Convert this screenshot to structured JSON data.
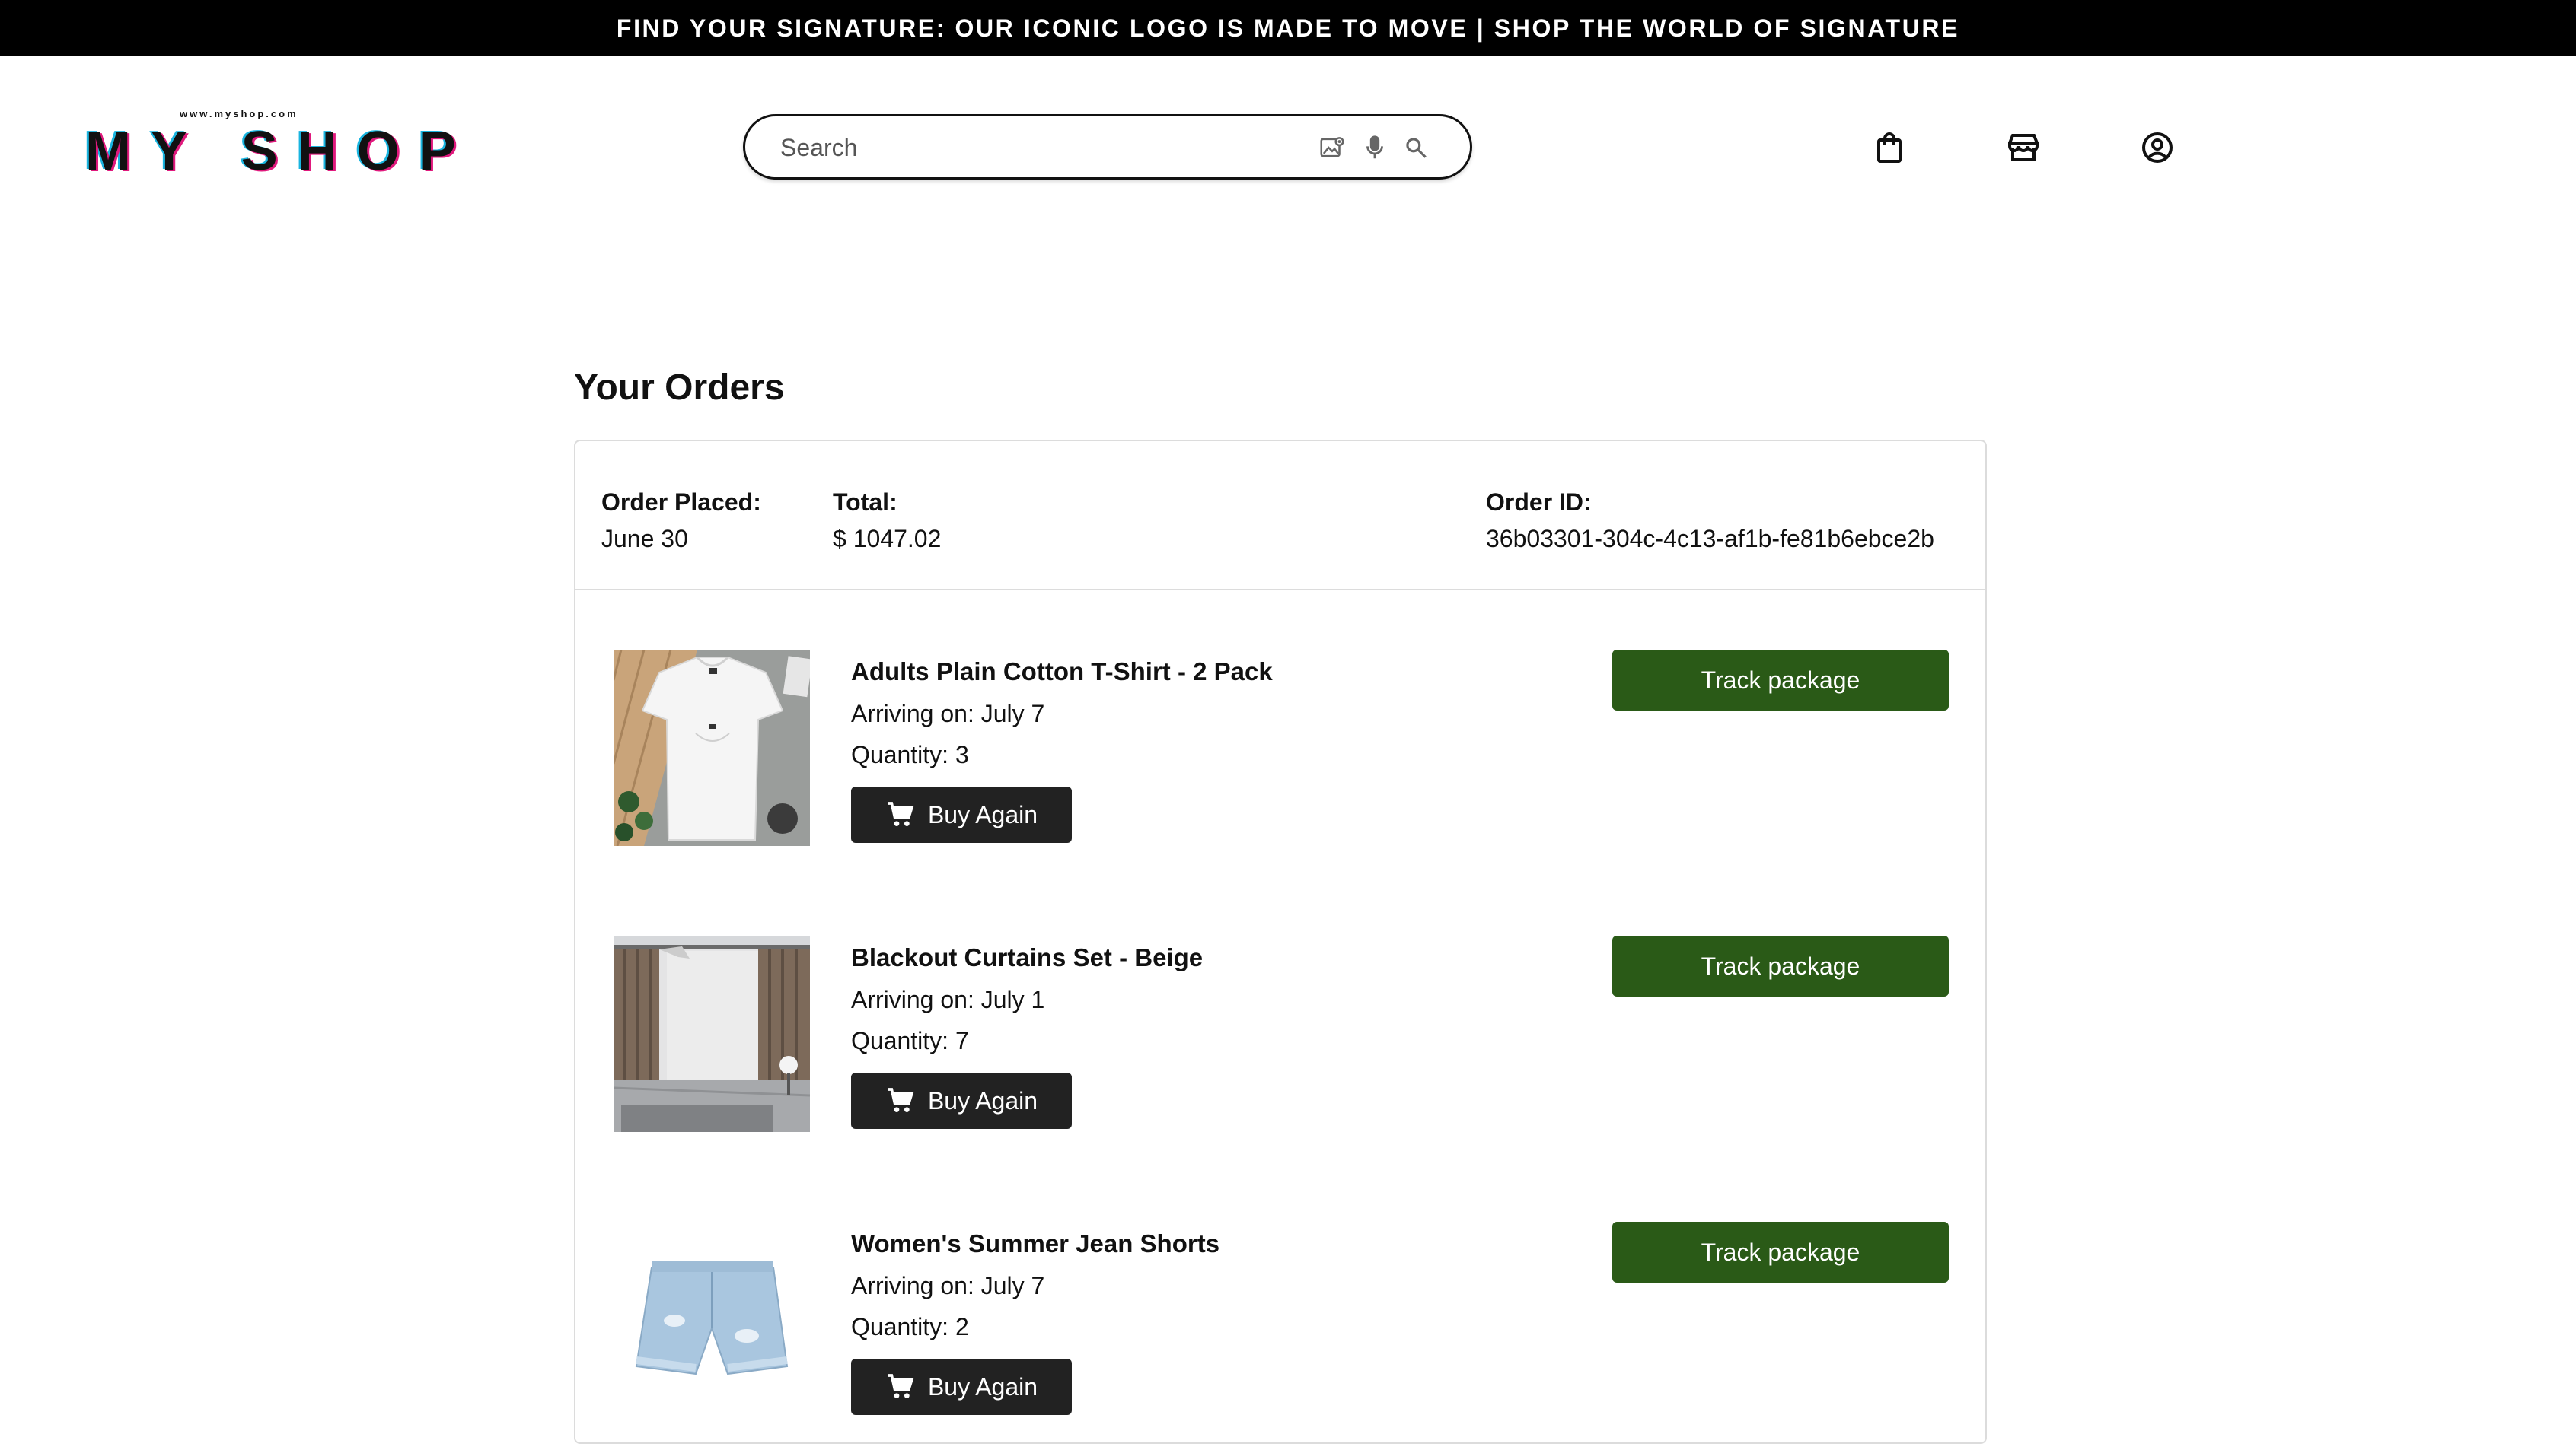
{
  "announcement": "FIND YOUR SIGNATURE: OUR ICONIC LOGO IS MADE TO MOVE | SHOP THE WORLD OF SIGNATURE",
  "logo": {
    "url": "www.myshop.com",
    "text": "MY SHOP"
  },
  "search": {
    "placeholder": "Search"
  },
  "header_icons": [
    "shopping-bag-icon",
    "store-icon",
    "account-icon"
  ],
  "page_title": "Your Orders",
  "order": {
    "placed_label": "Order Placed:",
    "placed_value": "June 30",
    "total_label": "Total:",
    "total_value": "$ 1047.02",
    "id_label": "Order ID:",
    "id_value": "36b03301-304c-4c13-af1b-fe81b6ebce2b",
    "items": [
      {
        "name": "Adults Plain Cotton T-Shirt - 2 Pack",
        "arriving": "Arriving on: July 7",
        "quantity": "Quantity: 3",
        "buy_again": "Buy Again",
        "track": "Track package"
      },
      {
        "name": "Blackout Curtains Set - Beige",
        "arriving": "Arriving on: July 1",
        "quantity": "Quantity: 7",
        "buy_again": "Buy Again",
        "track": "Track package"
      },
      {
        "name": "Women's Summer Jean Shorts",
        "arriving": "Arriving on: July 7",
        "quantity": "Quantity: 2",
        "buy_again": "Buy Again",
        "track": "Track package"
      }
    ]
  },
  "colors": {
    "announcement_bg": "#000000",
    "track_button": "#2a5a17",
    "buy_button": "#222222"
  }
}
